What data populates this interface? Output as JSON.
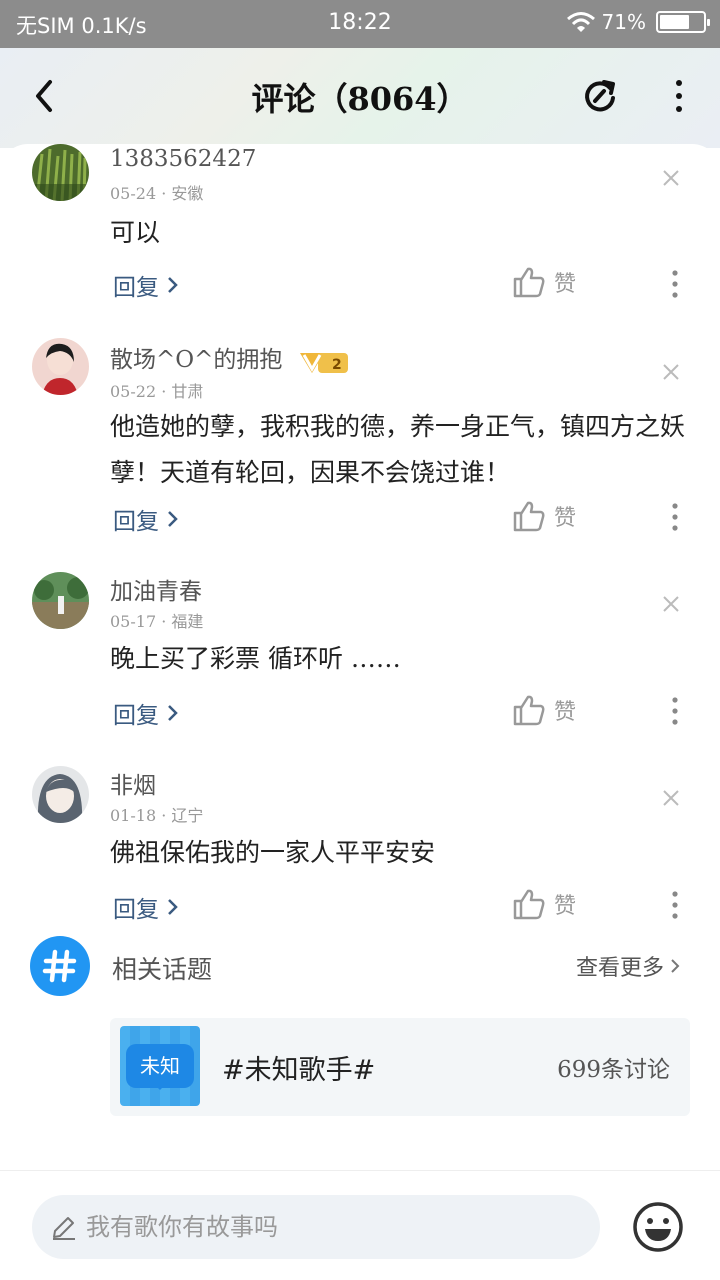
{
  "status_bar": {
    "carrier": "无SIM",
    "speed": "0.1K/s",
    "time": "18:22",
    "battery": "71%",
    "battery_level": 0.71
  },
  "header": {
    "title": "评论（8064）"
  },
  "comments": [
    {
      "username": "1383562427",
      "date": "05-24",
      "location": "安徽",
      "text": "可以",
      "reply": "回复",
      "like": "赞"
    },
    {
      "username": "散场^O^的拥抱",
      "badge": "V2",
      "date": "05-22",
      "location": "甘肃",
      "text": "他造她的孽，我积我的德，养一身正气，镇四方之妖孽！天道有轮回，因果不会饶过谁！",
      "reply": "回复",
      "like": "赞"
    },
    {
      "username": "加油青春",
      "date": "05-17",
      "location": "福建",
      "text": "晚上买了彩票  循环听 ……",
      "reply": "回复",
      "like": "赞"
    },
    {
      "username": "非烟",
      "date": "01-18",
      "location": "辽宁",
      "text": "佛祖保佑我的一家人平平安安",
      "reply": "回复",
      "like": "赞"
    }
  ],
  "related_topics": {
    "label": "相关话题",
    "see_more": "查看更多",
    "topic": {
      "thumb_text": "未知",
      "title": "#未知歌手#",
      "count": "699条讨论"
    }
  },
  "comment_input": {
    "placeholder": "我有歌你有故事吗"
  },
  "colors": {
    "accent": "#2196f3",
    "reply": "#3a5a80",
    "status_bar": "#8c8c8c"
  },
  "icons": [
    "back-icon",
    "share-icon",
    "more-icon",
    "close-icon",
    "like-icon",
    "dots-icon",
    "hashtag-icon",
    "pencil-icon",
    "emoji-icon"
  ]
}
